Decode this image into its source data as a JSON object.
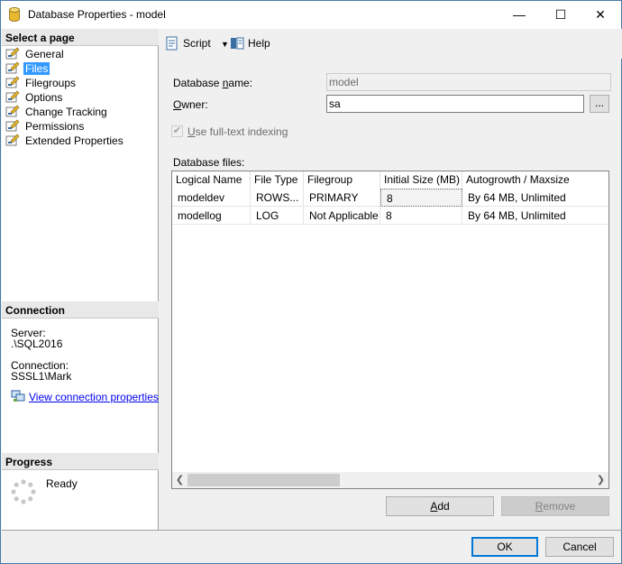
{
  "window": {
    "title": "Database Properties - model",
    "controls": {
      "minimize": "—",
      "maximize": "☐",
      "close": "✕"
    }
  },
  "left_pane": {
    "select_page_header": "Select a page",
    "pages": [
      {
        "label": "General",
        "icon": "wrench-page-icon",
        "selected": false
      },
      {
        "label": "Files",
        "icon": "wrench-page-icon",
        "selected": true
      },
      {
        "label": "Filegroups",
        "icon": "wrench-page-icon",
        "selected": false
      },
      {
        "label": "Options",
        "icon": "wrench-page-icon",
        "selected": false
      },
      {
        "label": "Change Tracking",
        "icon": "wrench-page-icon",
        "selected": false
      },
      {
        "label": "Permissions",
        "icon": "wrench-page-icon",
        "selected": false
      },
      {
        "label": "Extended Properties",
        "icon": "wrench-page-icon",
        "selected": false
      }
    ],
    "connection_header": "Connection",
    "server_label": "Server:",
    "server_value": ".\\SQL2016",
    "connection_label": "Connection:",
    "connection_value": "SSSL1\\Mark",
    "view_connection_link": "View connection properties",
    "progress_header": "Progress",
    "progress_status": "Ready"
  },
  "toolbar": {
    "script_label": "Script",
    "help_label": "Help"
  },
  "form": {
    "database_name_label_pre": "Database ",
    "database_name_label_ul": "n",
    "database_name_label_post": "ame:",
    "database_name_value": "model",
    "owner_label_ul": "O",
    "owner_label_post": "wner:",
    "owner_value": "sa",
    "owner_browse": "...",
    "fulltext_label_ul": "U",
    "fulltext_label_post": "se full-text indexing",
    "fulltext_checked": true,
    "database_files_label": "Database files:"
  },
  "files_grid": {
    "columns": [
      "Logical Name",
      "File Type",
      "Filegroup",
      "Initial Size (MB)",
      "Autogrowth / Maxsize"
    ],
    "rows": [
      [
        "modeldev",
        "ROWS...",
        "PRIMARY",
        "8",
        "By 64 MB, Unlimited"
      ],
      [
        "modellog",
        "LOG",
        "Not Applicable",
        "8",
        "By 64 MB, Unlimited"
      ]
    ]
  },
  "buttons": {
    "add_ul": "A",
    "add_post": "dd",
    "remove_ul": "R",
    "remove_post": "emove",
    "ok": "OK",
    "cancel": "Cancel"
  }
}
